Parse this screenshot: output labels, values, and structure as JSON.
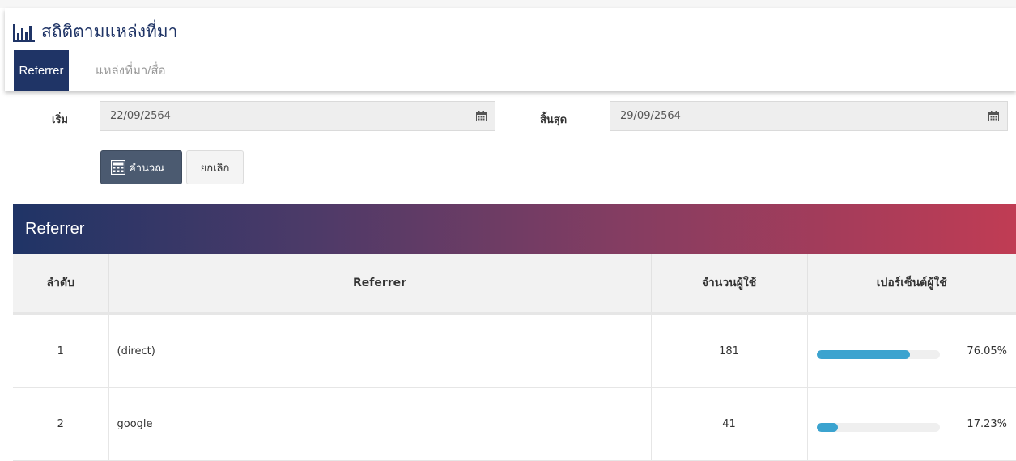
{
  "header": {
    "title": "สถิติตามแหล่งที่มา",
    "tabs": [
      {
        "label": "Referrer",
        "active": true
      },
      {
        "label": "แหล่งที่มา/สื่อ",
        "active": false
      }
    ]
  },
  "filter": {
    "start_label": "เริ่ม",
    "start_value": "22/09/2564",
    "end_label": "สิ้นสุด",
    "end_value": "29/09/2564",
    "calculate_label": "คำนวณ",
    "cancel_label": "ยกเลิก"
  },
  "card": {
    "title": "Referrer",
    "columns": [
      "ลำดับ",
      "Referrer",
      "จำนวนผู้ใช้",
      "เปอร์เซ็นต์ผู้ใช้"
    ],
    "rows": [
      {
        "rank": "1",
        "referrer": "(direct)",
        "users": "181",
        "percent_text": "76.05%",
        "percent": 76.05
      },
      {
        "rank": "2",
        "referrer": "google",
        "users": "41",
        "percent_text": "17.23%",
        "percent": 17.23
      }
    ]
  },
  "colors": {
    "brand": "#1f3466",
    "gradient_end": "#c03c54",
    "progress": "#3ba3cf",
    "calc_button": "#4b5a70"
  },
  "icons": {
    "title": "bar-chart-icon",
    "date": "calendar-icon",
    "calculate": "calculator-icon"
  }
}
